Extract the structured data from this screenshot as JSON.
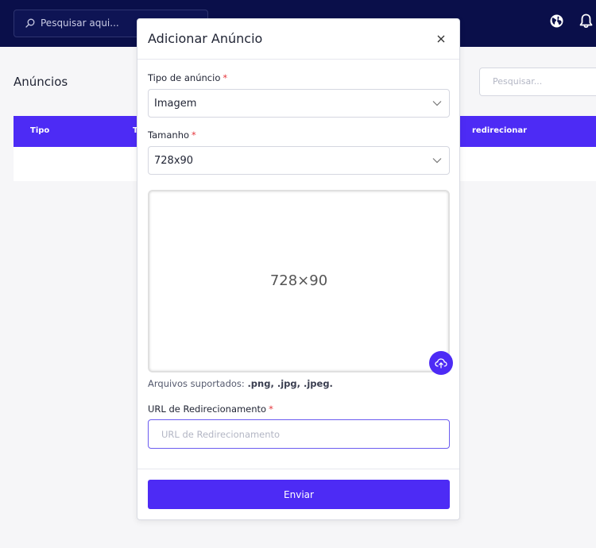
{
  "navbar": {
    "search_placeholder": "Pesquisar aqui...",
    "globe_icon": "globe-icon",
    "bell_icon": "bell-icon"
  },
  "page": {
    "title": "Anúncios",
    "search_placeholder": "Pesquisar...",
    "table": {
      "columns": [
        "Tipo",
        "T",
        "redirecionar"
      ]
    }
  },
  "modal": {
    "title": "Adicionar Anúncio",
    "close_icon": "close-icon",
    "type_field": {
      "label": "Tipo de anúncio",
      "required": "*",
      "value": "Imagem"
    },
    "size_field": {
      "label": "Tamanho",
      "required": "*",
      "value": "728x90"
    },
    "preview": {
      "text": "728×90"
    },
    "upload_icon": "cloud-upload-icon",
    "supported_prefix": "Arquivos suportados:",
    "supported_formats": ".png, .jpg, .jpeg.",
    "url_field": {
      "label": "URL de Redirecionamento",
      "required": "*",
      "placeholder": "URL de Redirecionamento",
      "value": ""
    },
    "submit_label": "Enviar"
  },
  "colors": {
    "navbar": "#0a0f4a",
    "accent": "#4d2bf5",
    "required": "#e5363c"
  }
}
